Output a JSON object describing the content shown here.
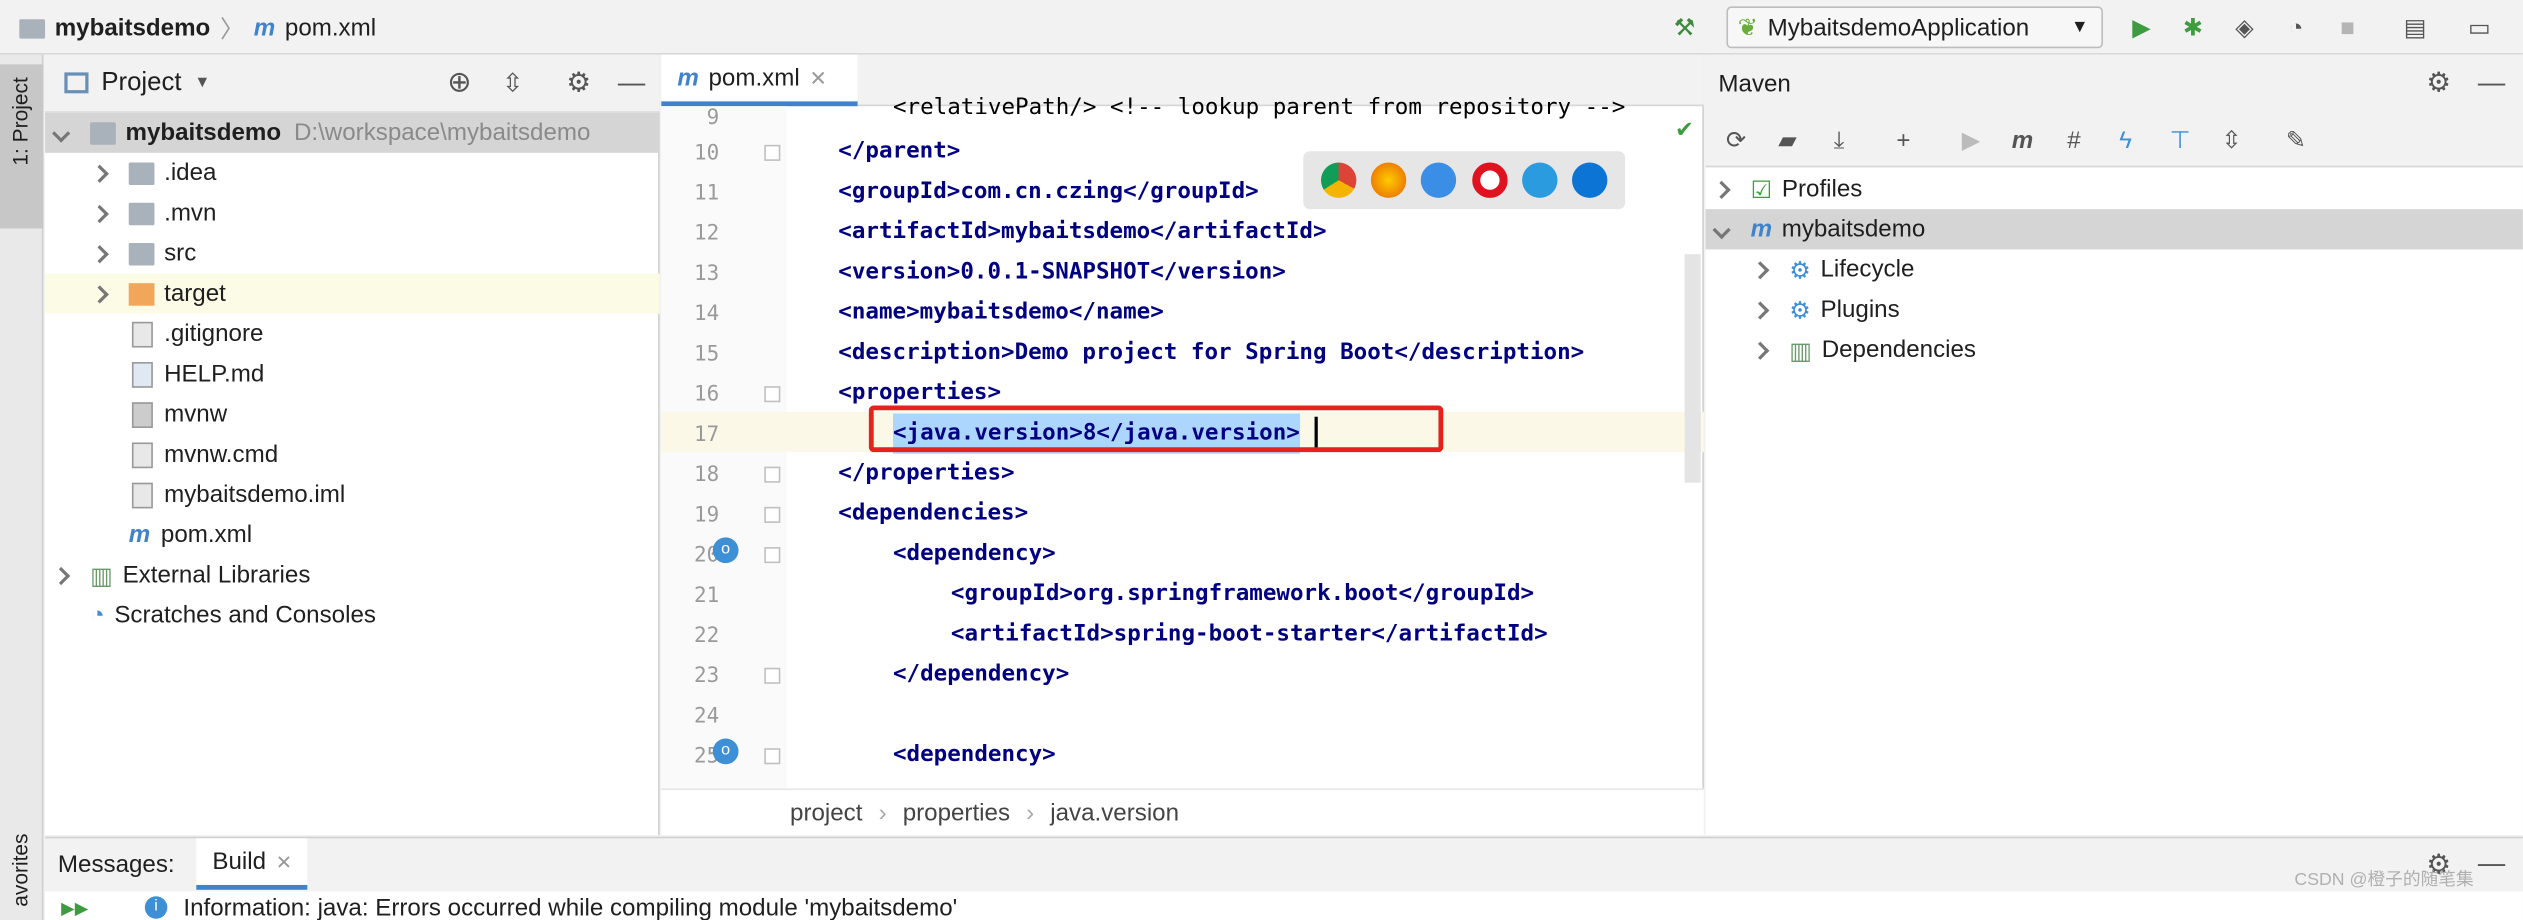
{
  "topbar": {
    "project_name": "mybaitsdemo",
    "file_name": "pom.xml",
    "run_config": "MybaitsdemoApplication"
  },
  "left_strip": {
    "project_tab": "1: Project",
    "favorites_tab": "avorites"
  },
  "project_panel": {
    "title": "Project",
    "root": {
      "name": "mybaitsdemo",
      "path": "D:\\workspace\\mybaitsdemo"
    },
    "items": [
      {
        "label": ".idea",
        "icon": "folder-icon"
      },
      {
        "label": ".mvn",
        "icon": "folder-icon"
      },
      {
        "label": "src",
        "icon": "folder-icon"
      },
      {
        "label": "target",
        "icon": "folder-orange-icon"
      },
      {
        "label": ".gitignore",
        "icon": "file-icon"
      },
      {
        "label": "HELP.md",
        "icon": "markdown-file-icon"
      },
      {
        "label": "mvnw",
        "icon": "shell-file-icon"
      },
      {
        "label": "mvnw.cmd",
        "icon": "text-file-icon"
      },
      {
        "label": "mybaitsdemo.iml",
        "icon": "iml-file-icon"
      },
      {
        "label": "pom.xml",
        "icon": "maven-file-icon"
      }
    ],
    "external_libraries": "External Libraries",
    "scratches": "Scratches and Consoles"
  },
  "editor": {
    "tab_label": "pom.xml",
    "lines": [
      {
        "num": "9",
        "code": "<relativePath/> <!-- lookup parent from repository -->"
      },
      {
        "num": "10",
        "code": "</parent>"
      },
      {
        "num": "11",
        "code": "<groupId>com.cn.czing</groupId>"
      },
      {
        "num": "12",
        "code": "<artifactId>mybaitsdemo</artifactId>"
      },
      {
        "num": "13",
        "code": "<version>0.0.1-SNAPSHOT</version>"
      },
      {
        "num": "14",
        "code": "<name>mybaitsdemo</name>"
      },
      {
        "num": "15",
        "code": "<description>Demo project for Spring Boot</description>"
      },
      {
        "num": "16",
        "code": "<properties>"
      },
      {
        "num": "17",
        "code": "<java.version>8</java.version>"
      },
      {
        "num": "18",
        "code": "</properties>"
      },
      {
        "num": "19",
        "code": "<dependencies>"
      },
      {
        "num": "20",
        "code": "<dependency>"
      },
      {
        "num": "21",
        "code": "<groupId>org.springframework.boot</groupId>"
      },
      {
        "num": "22",
        "code": "<artifactId>spring-boot-starter</artifactId>"
      },
      {
        "num": "23",
        "code": "</dependency>"
      },
      {
        "num": "24",
        "code": ""
      },
      {
        "num": "25",
        "code": "<dependency>"
      }
    ],
    "breadcrumb": [
      "project",
      "properties",
      "java.version"
    ]
  },
  "maven": {
    "title": "Maven",
    "tree": [
      {
        "label": "Profiles"
      },
      {
        "label": "mybaitsdemo"
      },
      {
        "label": "Lifecycle"
      },
      {
        "label": "Plugins"
      },
      {
        "label": "Dependencies"
      }
    ]
  },
  "bottom": {
    "messages": "Messages:",
    "build_tab": "Build",
    "info_line": "Information: java: Errors occurred while compiling module 'mybaitsdemo'",
    "watermark": "CSDN @橙子的随笔集"
  },
  "colors": {
    "accent": "#4083c9",
    "highlight_box": "#e8211c",
    "selection": "#add6ff",
    "tag": "#000080"
  }
}
